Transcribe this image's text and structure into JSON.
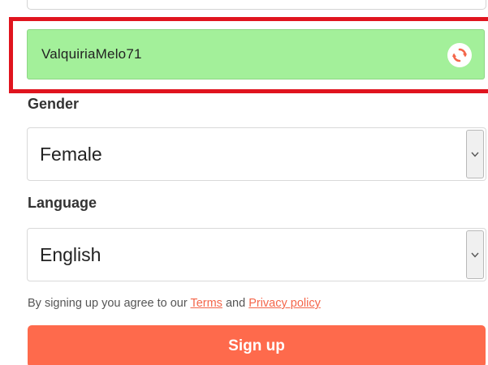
{
  "username": {
    "value": "ValquiriaMelo71",
    "status_color": "#a3f09a",
    "refresh_icon": "refresh-icon"
  },
  "gender": {
    "label": "Gender",
    "selected": "Female"
  },
  "language": {
    "label": "Language",
    "selected": "English"
  },
  "agreement": {
    "prefix": "By signing up you agree to our ",
    "terms_link": "Terms",
    "connector": " and ",
    "privacy_link": "Privacy policy"
  },
  "signup_button": {
    "label": "Sign up",
    "color": "#fe6a4c"
  },
  "highlight_color": "#e0141e"
}
